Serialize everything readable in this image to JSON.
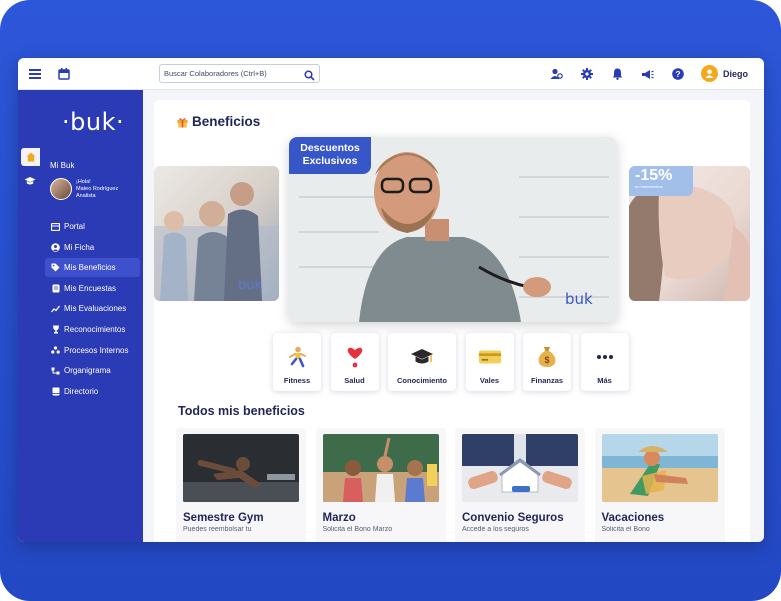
{
  "header": {
    "search_placeholder": "Buscar Colaboradores (Ctrl+B)",
    "user_name": "Diego",
    "icons": [
      "menu-icon",
      "calendar-icon",
      "search-icon",
      "people-icon",
      "gear-icon",
      "bell-icon",
      "megaphone-icon",
      "help-icon",
      "user-icon"
    ]
  },
  "sidebar": {
    "logo": "buk",
    "section_label": "Mi Buk",
    "profile": {
      "greeting": "¡Hola!",
      "name": "Mateo Rodríguez",
      "role": "Analista"
    },
    "items": [
      {
        "label": "Portal",
        "icon": "portal-icon",
        "active": false
      },
      {
        "label": "Mi Ficha",
        "icon": "user-circle-icon",
        "active": false
      },
      {
        "label": "Mis Beneficios",
        "icon": "tag-icon",
        "active": true
      },
      {
        "label": "Mis Encuestas",
        "icon": "survey-icon",
        "active": false
      },
      {
        "label": "Mis Evaluaciones",
        "icon": "chart-icon",
        "active": false
      },
      {
        "label": "Reconocimientos",
        "icon": "trophy-icon",
        "active": false
      },
      {
        "label": "Procesos Internos",
        "icon": "process-icon",
        "active": false
      },
      {
        "label": "Organigrama",
        "icon": "org-chart-icon",
        "active": false
      },
      {
        "label": "Directorio",
        "icon": "book-icon",
        "active": false
      }
    ]
  },
  "main": {
    "title": "Beneficios",
    "carousel": {
      "main_badge_line1": "Descuentos",
      "main_badge_line2": "Exclusivos",
      "watermark": "buk",
      "right_badge_pct": "-15%",
      "right_badge_text": "en tratamientos"
    },
    "categories": [
      {
        "label": "Fitness",
        "icon": "runner-icon"
      },
      {
        "label": "Salud",
        "icon": "heart-icon"
      },
      {
        "label": "Conocimiento",
        "icon": "graduation-cap-icon"
      },
      {
        "label": "Vales",
        "icon": "ticket-icon"
      },
      {
        "label": "Finanzas",
        "icon": "money-bag-icon"
      },
      {
        "label": "Más",
        "icon": "more-icon"
      }
    ],
    "section_title": "Todos mis beneficios",
    "cards": [
      {
        "title": "Semestre Gym",
        "desc": "Puedes reembolsar tu"
      },
      {
        "title": "Marzo",
        "desc": "Solicita el Bono Marzo"
      },
      {
        "title": "Convenio Seguros",
        "desc": "Accede a los seguros"
      },
      {
        "title": "Vacaciones",
        "desc": "Solicita el Bono"
      }
    ]
  },
  "colors": {
    "brand_blue": "#2b3bb5",
    "frame_blue": "#2c57d8",
    "accent_orange": "#f4a91c",
    "text_dark": "#1f2557"
  }
}
